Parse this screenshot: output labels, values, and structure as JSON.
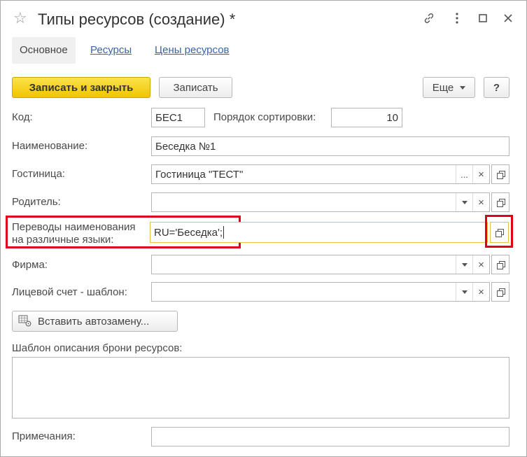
{
  "window": {
    "title": "Типы ресурсов (создание) *"
  },
  "tabs": [
    {
      "label": "Основное"
    },
    {
      "label": "Ресурсы"
    },
    {
      "label": "Цены ресурсов"
    }
  ],
  "toolbar": {
    "save_close_label": "Записать и закрыть",
    "save_label": "Записать",
    "more_label": "Еще",
    "help_label": "?"
  },
  "form": {
    "code_label": "Код:",
    "code_value": "БЕС1",
    "sort_label": "Порядок сортировки:",
    "sort_value": "10",
    "name_label": "Наименование:",
    "name_value": "Беседка №1",
    "hotel_label": "Гостиница:",
    "hotel_value": "Гостиница \"ТЕСТ\"",
    "parent_label": "Родитель:",
    "parent_value": "",
    "translations_label_line1": "Переводы наименования",
    "translations_label_line2": "на различные языки:",
    "translations_value": "RU='Беседка';",
    "firm_label": "Фирма:",
    "firm_value": "",
    "account_label": "Лицевой счет - шаблон:",
    "account_value": "",
    "insert_autoreplace_label": "Вставить автозамену...",
    "booking_template_label": "Шаблон описания брони ресурсов:",
    "notes_label": "Примечания:",
    "notes_value": ""
  },
  "icons": {
    "star": "star-icon",
    "link": "link-icon",
    "more": "more-vertical-icon",
    "maximize": "maximize-icon",
    "close": "close-icon",
    "copy": "open-copy-icon",
    "clear": "clear-icon",
    "dropdown": "dropdown-caret-icon",
    "select": "ellipsis-icon",
    "table": "table-gear-icon"
  },
  "colors": {
    "primary_button": "#f6d31b",
    "link": "#3b64a8",
    "highlight_red": "#e1001a",
    "active_field_border": "#e4bf4a"
  }
}
